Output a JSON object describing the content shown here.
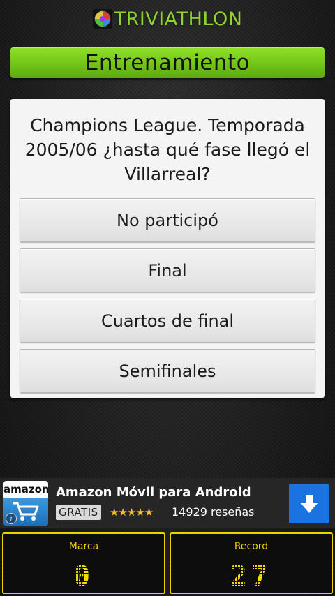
{
  "app": {
    "title": "TRIVIATHLON",
    "mode": "Entrenamiento",
    "logo_icon": "colorful-ball-icon"
  },
  "question": {
    "text": "Champions League. Temporada 2005/06 ¿hasta qué fase llegó el Villarreal?",
    "answers": [
      "No participó",
      "Final",
      "Cuartos de final",
      "Semifinales"
    ]
  },
  "ad": {
    "logo_text": "amazon",
    "title": "Amazon Móvil para Android",
    "badge": "GRATIS",
    "stars": "★★★★★",
    "rating": 4.5,
    "reviews": "14929 reseñas",
    "info_icon": "info-icon",
    "download_icon": "download-arrow-icon"
  },
  "scores": {
    "marca_label": "Marca",
    "marca_value": "0",
    "record_label": "Record",
    "record_value": "27"
  },
  "colors": {
    "accent_green": "#72c418",
    "score_yellow": "#e8d400",
    "ad_blue": "#1a73e0"
  }
}
